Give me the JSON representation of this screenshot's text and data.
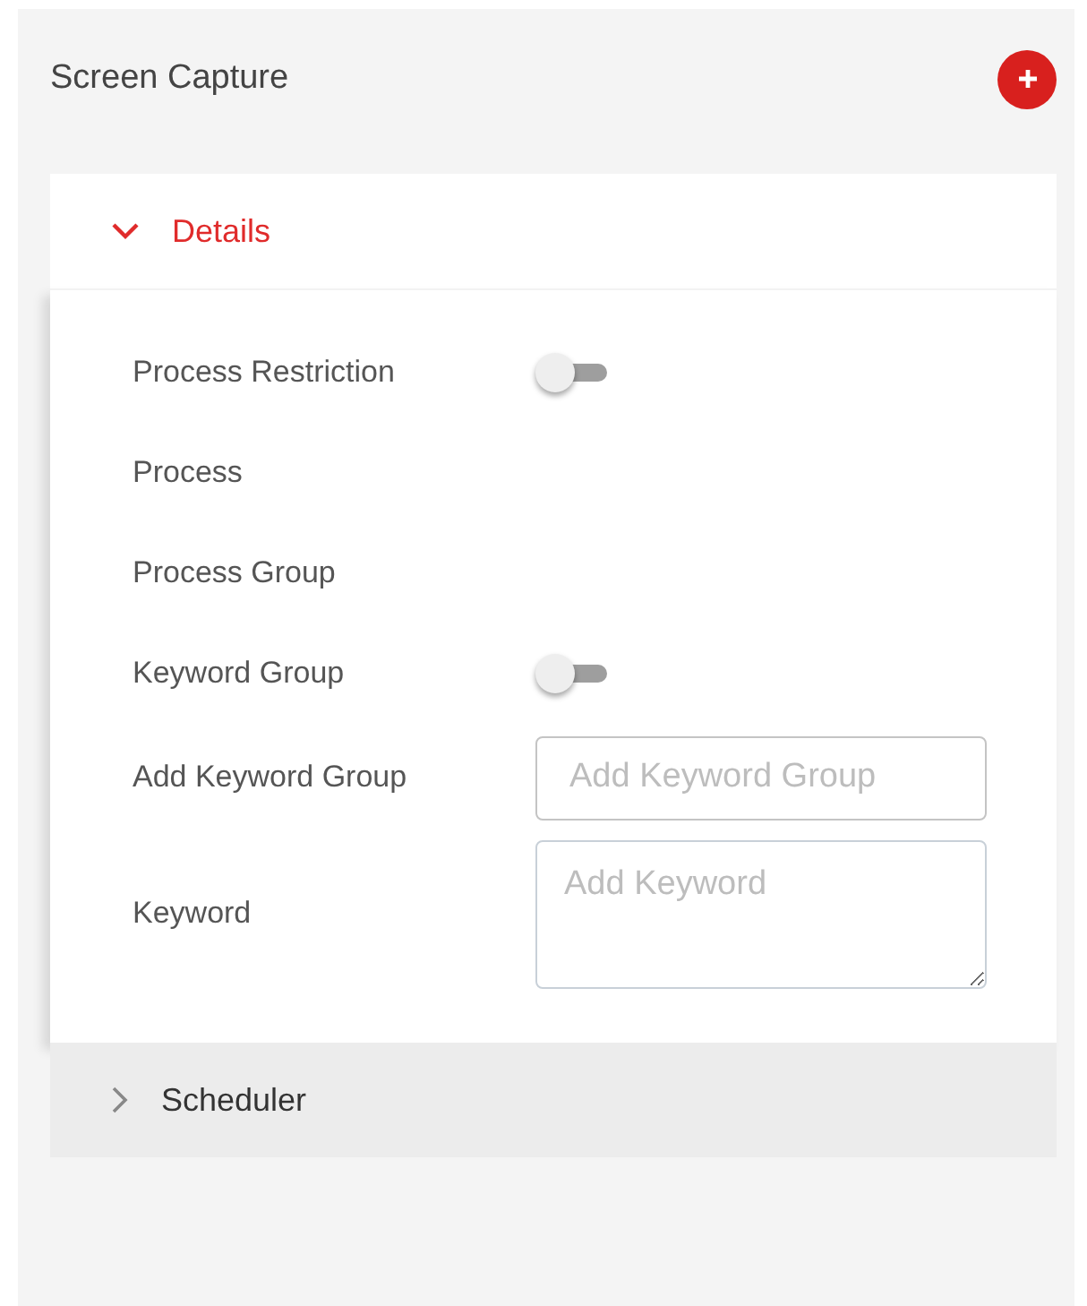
{
  "panel": {
    "title": "Screen Capture"
  },
  "sections": [
    {
      "title": "Details",
      "expanded": true,
      "fields": [
        {
          "label": "Process Restriction",
          "kind": "toggle",
          "on": false
        },
        {
          "label": "Process",
          "kind": "label"
        },
        {
          "label": "Process Group",
          "kind": "label"
        },
        {
          "label": "Keyword Group",
          "kind": "toggle",
          "on": false
        },
        {
          "label": "Add Keyword Group",
          "kind": "input",
          "placeholder": "Add Keyword Group"
        },
        {
          "label": "Keyword",
          "kind": "textarea",
          "placeholder": "Add Keyword"
        }
      ]
    },
    {
      "title": "Scheduler",
      "expanded": false
    }
  ]
}
